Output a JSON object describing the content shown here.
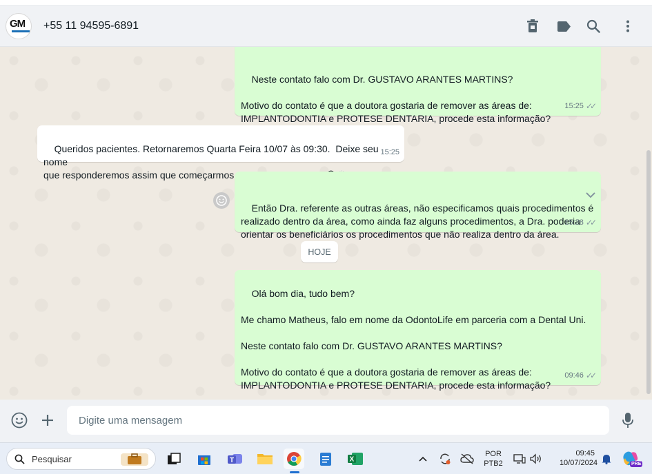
{
  "header": {
    "avatar_text": "GM",
    "contact": "+55 11 94595-6891"
  },
  "messages": [
    {
      "id": "m1",
      "text": "Neste contato falo com Dr. GUSTAVO ARANTES MARTINS?\n\nMotivo do contato é que a doutora gostaria de remover as áreas de:\nIMPLANTODONTIA e PROTESE DENTARIA, procede esta informação?",
      "time": "15:25"
    },
    {
      "id": "m2",
      "text": "Queridos pacientes. Retornaremos Quarta Feira 10/07 às 09:30.  Deixe seu nome\nque responderemos assim que começarmos nosso expediente !!! 😊🙌",
      "time": "15:25"
    },
    {
      "id": "m3",
      "text": "Então Dra. referente as outras áreas, não especificamos quais procedimentos é\nrealizado dentro da área, como ainda faz alguns procedimentos, a Dra. poderia\norientar os beneficiários os procedimentos que não realiza dentro da área.",
      "time": "15:28"
    },
    {
      "id": "m4",
      "text": "Olá bom dia, tudo bem?\n\nMe chamo Matheus, falo em nome da OdontoLife em parceria com a Dental Uni.\n\nNeste contato falo com Dr. GUSTAVO ARANTES MARTINS?\n\nMotivo do contato é que a doutora gostaria de remover as áreas de:\nIMPLANTODONTIA e PROTESE DENTARIA, procede esta informação?",
      "time": "09:46"
    }
  ],
  "date_divider": "HOJE",
  "composer": {
    "placeholder": "Digite uma mensagem"
  },
  "taskbar": {
    "search_label": "Pesquisar",
    "lang_top": "POR",
    "lang_bottom": "PTB2",
    "time": "09:45",
    "date": "10/07/2024",
    "copilot_badge": "PRE"
  },
  "colors": {
    "outgoing_bubble": "#d9fdd3",
    "incoming_bubble": "#ffffff",
    "chat_bg": "#efeae2"
  }
}
